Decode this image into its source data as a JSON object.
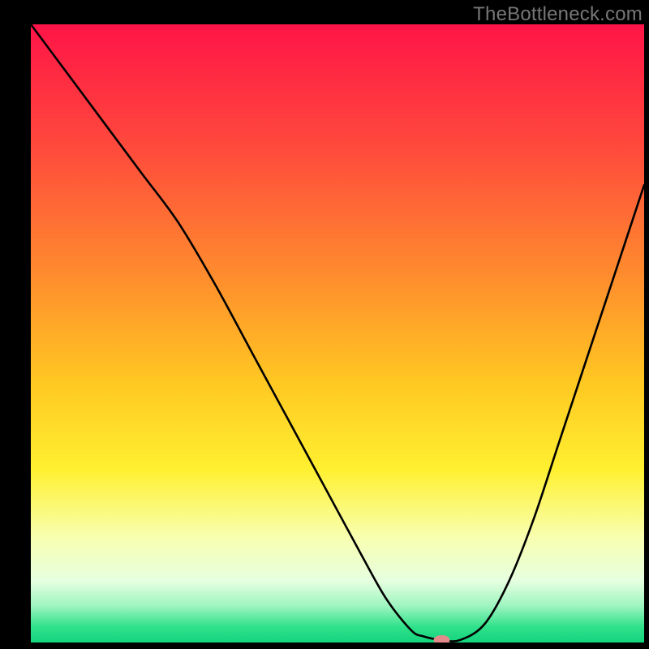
{
  "watermark": "TheBottleneck.com",
  "chart_data": {
    "type": "line",
    "title": "",
    "xlabel": "",
    "ylabel": "",
    "xlim": [
      0,
      100
    ],
    "ylim": [
      0,
      100
    ],
    "grid": false,
    "legend": false,
    "series": [
      {
        "name": "curve",
        "x": [
          0,
          6,
          12,
          18,
          24,
          30,
          36,
          42,
          48,
          54,
          58,
          62,
          64,
          67,
          70,
          74,
          78,
          82,
          86,
          90,
          94,
          98,
          100
        ],
        "y": [
          100,
          92,
          84,
          76,
          68,
          58,
          47,
          36,
          25,
          14,
          7,
          2,
          1,
          0.4,
          0.4,
          3,
          10,
          20,
          32,
          44,
          56,
          68,
          74
        ]
      }
    ],
    "background_gradient": {
      "stops": [
        {
          "offset": 0,
          "color": "#ff1447"
        },
        {
          "offset": 0.2,
          "color": "#ff4a3c"
        },
        {
          "offset": 0.4,
          "color": "#ff8a2e"
        },
        {
          "offset": 0.58,
          "color": "#ffc822"
        },
        {
          "offset": 0.72,
          "color": "#fff030"
        },
        {
          "offset": 0.83,
          "color": "#f8ffb0"
        },
        {
          "offset": 0.9,
          "color": "#e6ffe0"
        },
        {
          "offset": 0.94,
          "color": "#a0f5c0"
        },
        {
          "offset": 0.975,
          "color": "#2fe18a"
        },
        {
          "offset": 1.0,
          "color": "#14d47e"
        }
      ]
    },
    "marker": {
      "x": 67,
      "y": 0.4,
      "rx": 10,
      "ry": 6,
      "color": "#e38b8b"
    }
  }
}
